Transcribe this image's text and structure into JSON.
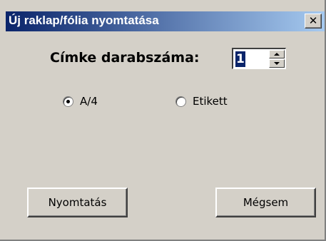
{
  "window": {
    "title": "Új raklap/fólia nyomtatása",
    "close_glyph": "✕"
  },
  "form": {
    "count_label": "Címke darabszáma:",
    "count_value": "1",
    "radios": [
      {
        "label": "A/4",
        "checked": true
      },
      {
        "label": "Etikett",
        "checked": false
      }
    ]
  },
  "buttons": {
    "print_label": "Nyomtatás",
    "cancel_label": "Mégsem"
  },
  "colors": {
    "titlebar_start": "#0a246a",
    "titlebar_end": "#a6caf0",
    "dialog_bg": "#d4d0c8"
  }
}
